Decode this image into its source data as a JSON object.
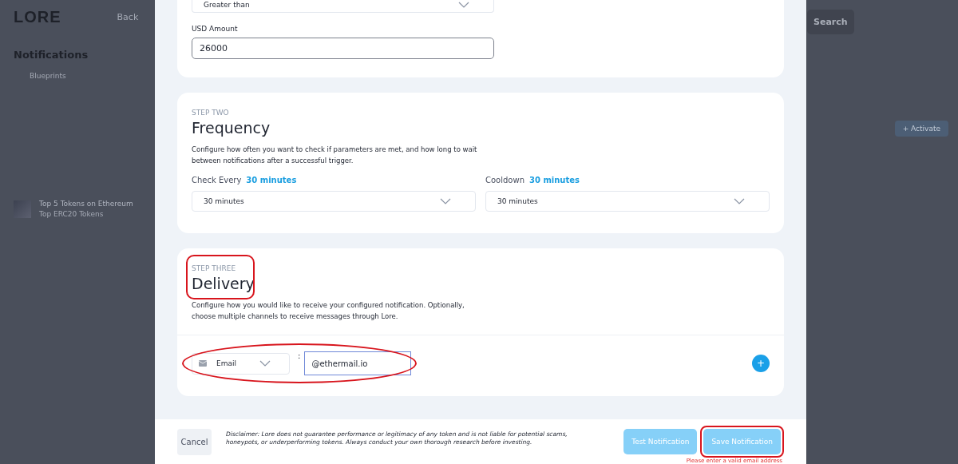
{
  "background": {
    "logo": "LORE",
    "back_link": "Back",
    "heading": "Notifications",
    "tabs": [
      "Blueprints"
    ],
    "items": [
      {
        "title": "Top 5 Tokens on Ethereum",
        "subtitle": "Top ERC20 Tokens"
      }
    ],
    "search_button": "Search",
    "activate_button": "+ Activate"
  },
  "modal": {
    "condition_card": {
      "operator": "Greater than",
      "amount_label": "USD Amount",
      "amount_value": "26000"
    },
    "frequency": {
      "step": "STEP TWO",
      "title": "Frequency",
      "description": "Configure how often you want to check if parameters are met, and how long to wait between notifications after a successful trigger.",
      "fields": [
        {
          "label": "Check Every",
          "current": "30 minutes",
          "value": "30 minutes"
        },
        {
          "label": "Cooldown",
          "current": "30 minutes",
          "value": "30 minutes"
        }
      ]
    },
    "delivery": {
      "step": "STEP THREE",
      "title": "Delivery",
      "description": "Configure how you would like to receive your configured notification. Optionally, choose multiple channels to receive messages through Lore.",
      "channels": [
        {
          "type": "Email",
          "separator": ":",
          "value": "@ethermail.io"
        }
      ],
      "add_button": "+"
    },
    "footer": {
      "cancel": "Cancel",
      "disclaimer": "Disclaimer: Lore does not guarantee performance or legitimacy of any token and is not liable for potential scams, honeypots, or underperforming tokens. Always conduct your own thorough research before investing.",
      "test_button": "Test Notification",
      "save_button": "Save Notification",
      "error": "Please enter a valid email address"
    }
  }
}
